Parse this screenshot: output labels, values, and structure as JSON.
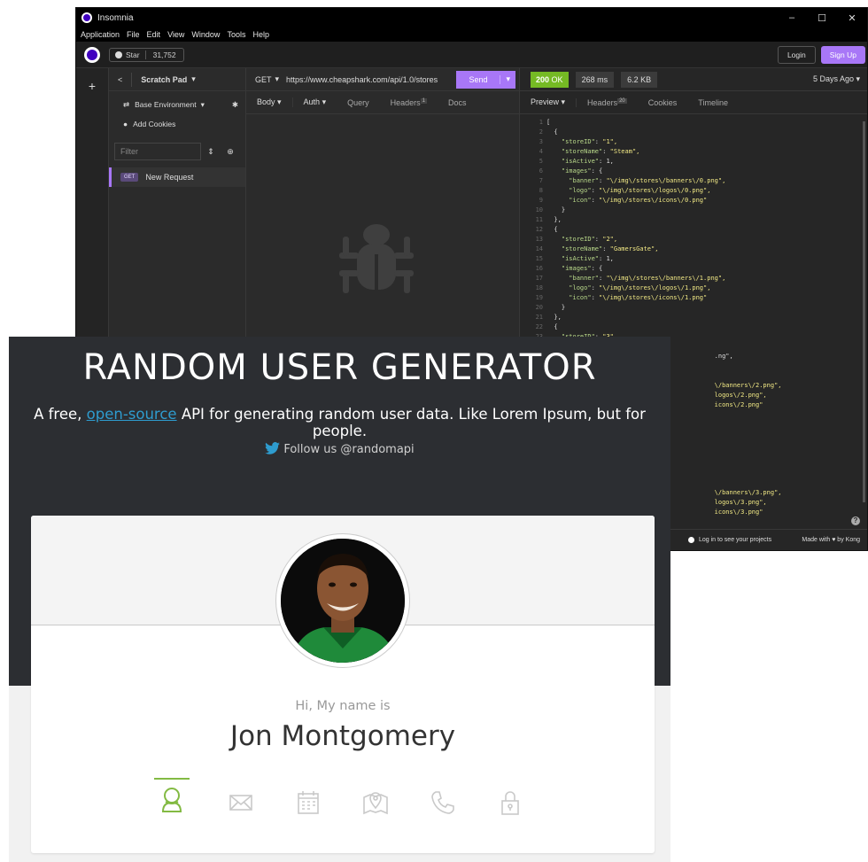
{
  "insomnia": {
    "window_title": "Insomnia",
    "window_controls": [
      "–",
      "☐",
      "✕"
    ],
    "menu": [
      "Application",
      "File",
      "Edit",
      "View",
      "Window",
      "Tools",
      "Help"
    ],
    "github_star_label": "Star",
    "github_star_count": "31,752",
    "login_label": "Login",
    "signup_label": "Sign Up",
    "rail_plus": "+",
    "sidebar": {
      "back": "<",
      "workspace": "Scratch Pad",
      "environment": "Base Environment",
      "add_cookies": "Add Cookies",
      "filter_placeholder": "Filter",
      "request_method": "GET",
      "request_name": "New Request"
    },
    "request": {
      "method": "GET",
      "url": "https://www.cheapshark.com/api/1.0/stores",
      "send_label": "Send",
      "tabs": [
        "Body",
        "Auth",
        "Query",
        "Headers",
        "Docs"
      ],
      "headers_count": "1"
    },
    "response": {
      "status_code": "200",
      "status_text": "OK",
      "time": "268 ms",
      "size": "6.2 KB",
      "age": "5 Days Ago",
      "tabs": [
        "Preview",
        "Headers",
        "Cookies",
        "Timeline"
      ],
      "headers_count": "20",
      "code_lines": [
        {
          "n": "1",
          "text": "["
        },
        {
          "n": "2",
          "text": "  {"
        },
        {
          "n": "3",
          "key": "\"storeID\"",
          "val": "\"1\","
        },
        {
          "n": "4",
          "key": "\"storeName\"",
          "val": "\"Steam\","
        },
        {
          "n": "5",
          "key": "\"isActive\"",
          "val": "1,"
        },
        {
          "n": "6",
          "key": "\"images\"",
          "val": "{"
        },
        {
          "n": "7",
          "key": "  \"banner\"",
          "val": "\"\\/img\\/stores\\/banners\\/0.png\","
        },
        {
          "n": "8",
          "key": "  \"logo\"",
          "val": "\"\\/img\\/stores\\/logos\\/0.png\","
        },
        {
          "n": "9",
          "key": "  \"icon\"",
          "val": "\"\\/img\\/stores\\/icons\\/0.png\""
        },
        {
          "n": "10",
          "text": "    }"
        },
        {
          "n": "11",
          "text": "  },"
        },
        {
          "n": "12",
          "text": "  {"
        },
        {
          "n": "13",
          "key": "\"storeID\"",
          "val": "\"2\","
        },
        {
          "n": "14",
          "key": "\"storeName\"",
          "val": "\"GamersGate\","
        },
        {
          "n": "15",
          "key": "\"isActive\"",
          "val": "1,"
        },
        {
          "n": "16",
          "key": "\"images\"",
          "val": "{"
        },
        {
          "n": "17",
          "key": "  \"banner\"",
          "val": "\"\\/img\\/stores\\/banners\\/1.png\","
        },
        {
          "n": "18",
          "key": "  \"logo\"",
          "val": "\"\\/img\\/stores\\/logos\\/1.png\","
        },
        {
          "n": "19",
          "key": "  \"icon\"",
          "val": "\"\\/img\\/stores\\/icons\\/1.png\""
        },
        {
          "n": "20",
          "text": "    }"
        },
        {
          "n": "21",
          "text": "  },"
        },
        {
          "n": "22",
          "text": "  {"
        },
        {
          "n": "23",
          "key": "\"storeID\"",
          "val": "\"3\","
        },
        {
          "n": "",
          "text": ""
        },
        {
          "n": "",
          "text": "                                             .ng\","
        },
        {
          "n": "",
          "text": ""
        },
        {
          "n": "",
          "text": ""
        },
        {
          "n": "",
          "text": "                                             \\/banners\\/2.png\","
        },
        {
          "n": "",
          "text": "                                             logos\\/2.png\","
        },
        {
          "n": "",
          "text": "                                             icons\\/2.png\""
        },
        {
          "n": "",
          "text": ""
        },
        {
          "n": "",
          "text": ""
        },
        {
          "n": "",
          "text": ""
        },
        {
          "n": "",
          "text": ""
        },
        {
          "n": "",
          "text": ""
        },
        {
          "n": "",
          "text": ""
        },
        {
          "n": "",
          "text": ""
        },
        {
          "n": "",
          "text": ""
        },
        {
          "n": "",
          "text": "                                             \\/banners\\/3.png\","
        },
        {
          "n": "",
          "text": "                                             logos\\/3.png\","
        },
        {
          "n": "",
          "text": "                                             icons\\/3.png\""
        }
      ],
      "footer_login": "Log in to see your projects",
      "footer_made_with": "Made with ♥ by Kong"
    }
  },
  "rug": {
    "title": "RANDOM USER GENERATOR",
    "subtitle_prefix": "A free, ",
    "subtitle_link": "open-source",
    "subtitle_suffix": " API for generating random user data. Like Lorem Ipsum, but for people.",
    "follow": "Follow us @randomapi",
    "greeting": "Hi, My name is",
    "name": "Jon Montgomery",
    "icons": [
      "user-icon",
      "mail-icon",
      "calendar-icon",
      "map-icon",
      "phone-icon",
      "lock-icon"
    ],
    "accent_color": "#83ba43",
    "link_color": "#2e9ccf"
  }
}
